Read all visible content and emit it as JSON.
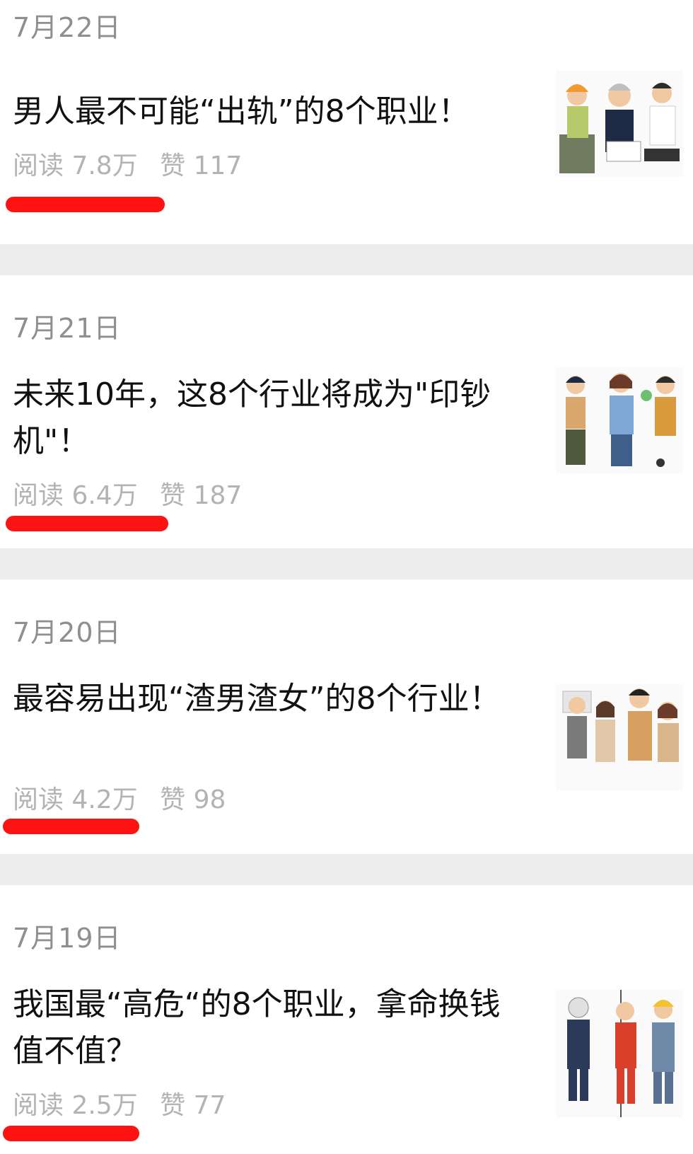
{
  "articles": [
    {
      "date": "7月22日",
      "title": "男人最不可能“出轨”的8个职业！",
      "read_label": "阅读 7.8万",
      "like_label": "赞 117",
      "thumbnail_icon": "illustration-workers-icon"
    },
    {
      "date": "7月21日",
      "title": "未来10年，这8个行业将成为\"印钞机\"！",
      "read_label": "阅读 6.4万",
      "like_label": "赞 187",
      "thumbnail_icon": "illustration-women-workers-icon"
    },
    {
      "date": "7月20日",
      "title": "最容易出现“渣男渣女”的8个行业！",
      "read_label": "阅读 4.2万",
      "like_label": "赞 98",
      "thumbnail_icon": "illustration-couples-icon"
    },
    {
      "date": "7月19日",
      "title": "我国最“高危“的8个职业，拿命换钱值不值？",
      "read_label": "阅读 2.5万",
      "like_label": "赞 77",
      "thumbnail_icon": "illustration-hazard-workers-icon"
    }
  ],
  "colors": {
    "underline": "#ff1212",
    "separator": "#ededed",
    "meta_text": "#b3b3b3",
    "date_text": "#8f8f8f"
  }
}
